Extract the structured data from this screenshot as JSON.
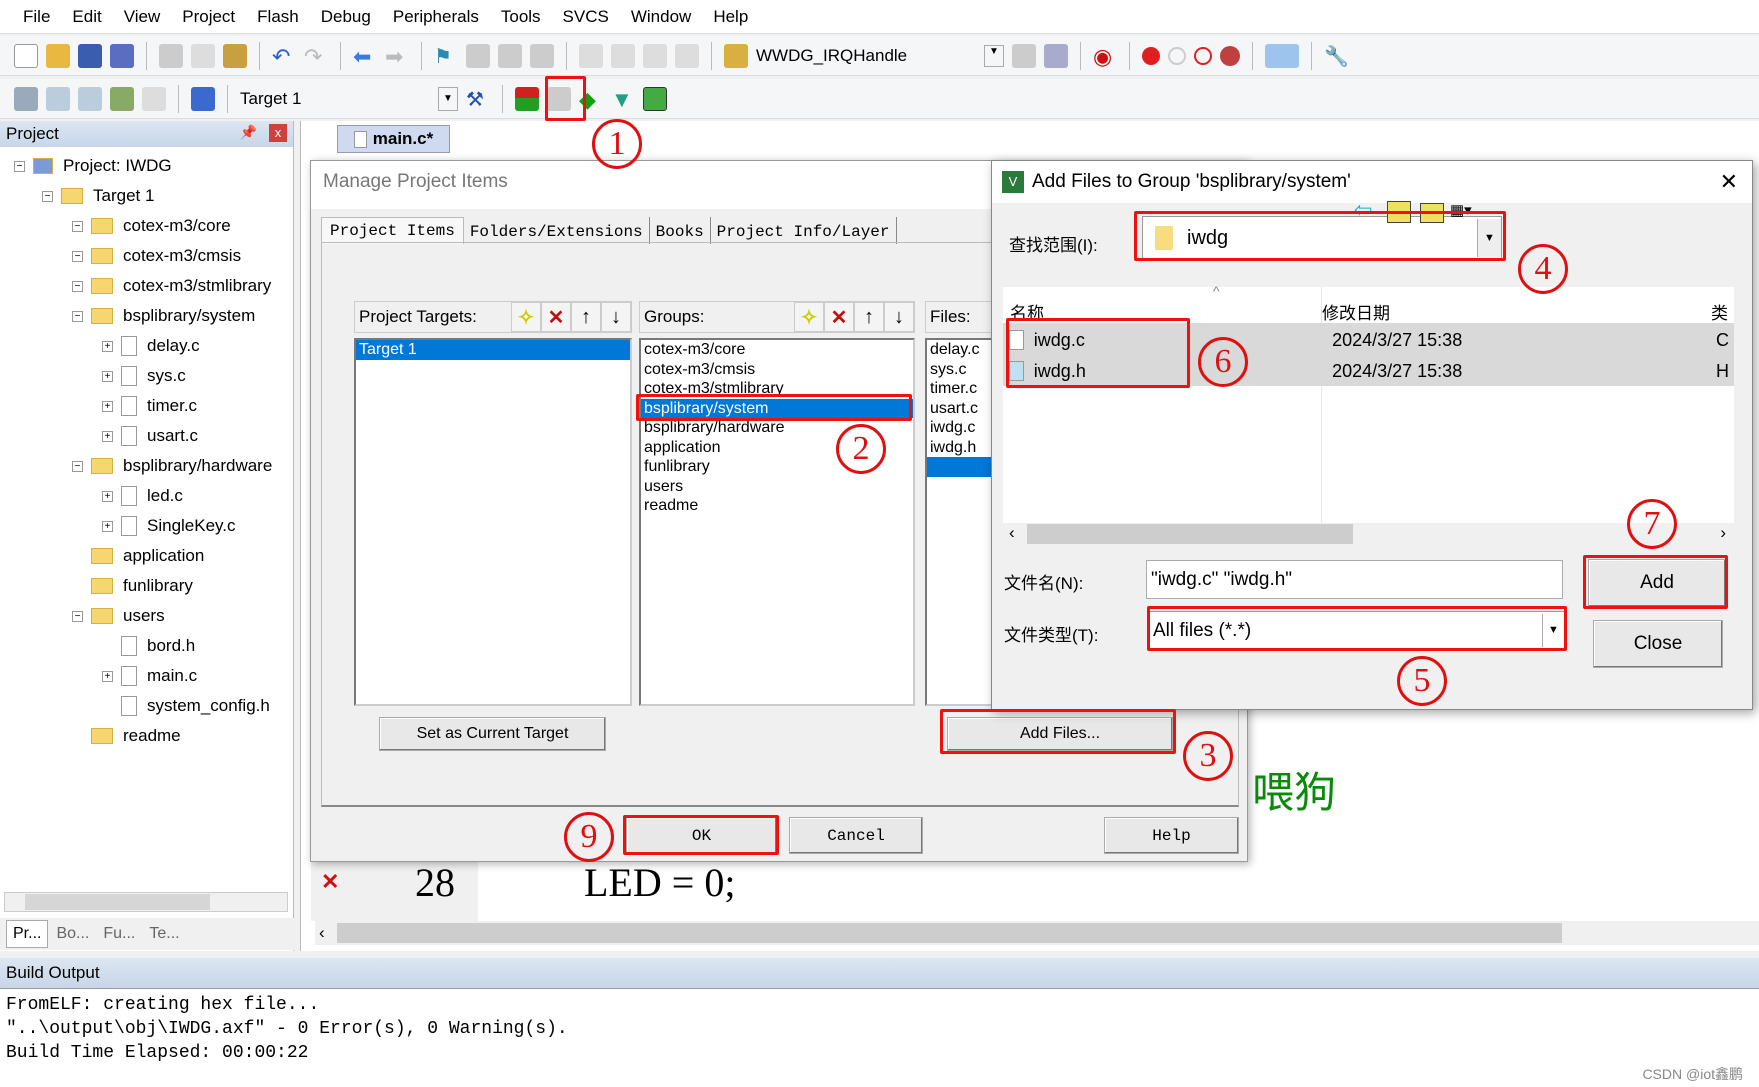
{
  "menu": [
    "File",
    "Edit",
    "View",
    "Project",
    "Flash",
    "Debug",
    "Peripherals",
    "Tools",
    "SVCS",
    "Window",
    "Help"
  ],
  "toolbar": {
    "function_combo": "WWDG_IRQHandle",
    "target_combo": "Target 1"
  },
  "project_panel": {
    "title": "Project",
    "tree": [
      {
        "label": "Project: IWDG",
        "level": 0,
        "type": "project"
      },
      {
        "label": "Target 1",
        "level": 1,
        "type": "target"
      },
      {
        "label": "cotex-m3/core",
        "level": 2,
        "type": "folder"
      },
      {
        "label": "cotex-m3/cmsis",
        "level": 2,
        "type": "folder"
      },
      {
        "label": "cotex-m3/stmlibrary",
        "level": 2,
        "type": "folder"
      },
      {
        "label": "bsplibrary/system",
        "level": 2,
        "type": "folder"
      },
      {
        "label": "delay.c",
        "level": 3,
        "type": "file"
      },
      {
        "label": "sys.c",
        "level": 3,
        "type": "file"
      },
      {
        "label": "timer.c",
        "level": 3,
        "type": "file"
      },
      {
        "label": "usart.c",
        "level": 3,
        "type": "file"
      },
      {
        "label": "bsplibrary/hardware",
        "level": 2,
        "type": "folder"
      },
      {
        "label": "led.c",
        "level": 3,
        "type": "file"
      },
      {
        "label": "SingleKey.c",
        "level": 3,
        "type": "file"
      },
      {
        "label": "application",
        "level": 2,
        "type": "folder"
      },
      {
        "label": "funlibrary",
        "level": 2,
        "type": "folder"
      },
      {
        "label": "users",
        "level": 2,
        "type": "folder"
      },
      {
        "label": "bord.h",
        "level": 3,
        "type": "file"
      },
      {
        "label": "main.c",
        "level": 3,
        "type": "file"
      },
      {
        "label": "system_config.h",
        "level": 3,
        "type": "file"
      },
      {
        "label": "readme",
        "level": 2,
        "type": "folder"
      }
    ],
    "bottom_tabs": [
      "Pr...",
      "Bo...",
      "Fu...",
      "Te..."
    ]
  },
  "editor": {
    "tab": "main.c*",
    "line_number": "28",
    "code": "LED = 0;",
    "comment": "喂狗"
  },
  "manage_dialog": {
    "title": "Manage Project Items",
    "tabs": [
      "Project Items",
      "Folders/Extensions",
      "Books",
      "Project Info/Layer"
    ],
    "targets_label": "Project Targets:",
    "targets": [
      "Target 1"
    ],
    "groups_label": "Groups:",
    "groups": [
      "cotex-m3/core",
      "cotex-m3/cmsis",
      "cotex-m3/stmlibrary",
      "bsplibrary/system",
      "bsplibrary/hardware",
      "application",
      "funlibrary",
      "users",
      "readme"
    ],
    "selected_group": "bsplibrary/system",
    "files_label": "Files:",
    "files": [
      "delay.c",
      "sys.c",
      "timer.c",
      "usart.c",
      "iwdg.c",
      "iwdg.h"
    ],
    "set_current": "Set as Current Target",
    "add_files": "Add Files...",
    "ok": "OK",
    "cancel": "Cancel",
    "help": "Help"
  },
  "add_dialog": {
    "title": "Add Files to Group 'bsplibrary/system'",
    "look_in_label": "查找范围(I):",
    "look_in": "iwdg",
    "col_name": "名称",
    "col_date": "修改日期",
    "col_type": "类",
    "files": [
      {
        "name": "iwdg.c",
        "date": "2024/3/27 15:38",
        "type": "C"
      },
      {
        "name": "iwdg.h",
        "date": "2024/3/27 15:38",
        "type": "H"
      }
    ],
    "filename_label": "文件名(N):",
    "filename": "\"iwdg.c\" \"iwdg.h\"",
    "filetype_label": "文件类型(T):",
    "filetype": "All files (*.*)",
    "add": "Add",
    "close": "Close"
  },
  "build_output": {
    "title": "Build Output",
    "lines": [
      "FromELF: creating hex file...",
      "\"..\\output\\obj\\IWDG.axf\" - 0 Error(s), 0 Warning(s).",
      "Build Time Elapsed:  00:00:22"
    ]
  },
  "annotations": [
    "1",
    "2",
    "3",
    "4",
    "5",
    "6",
    "7",
    "9"
  ],
  "watermark": "CSDN @iot鑫鹏",
  "colors": {
    "annotation": "#e01010",
    "selection": "#0078d7",
    "comment": "#0a8a0a"
  }
}
